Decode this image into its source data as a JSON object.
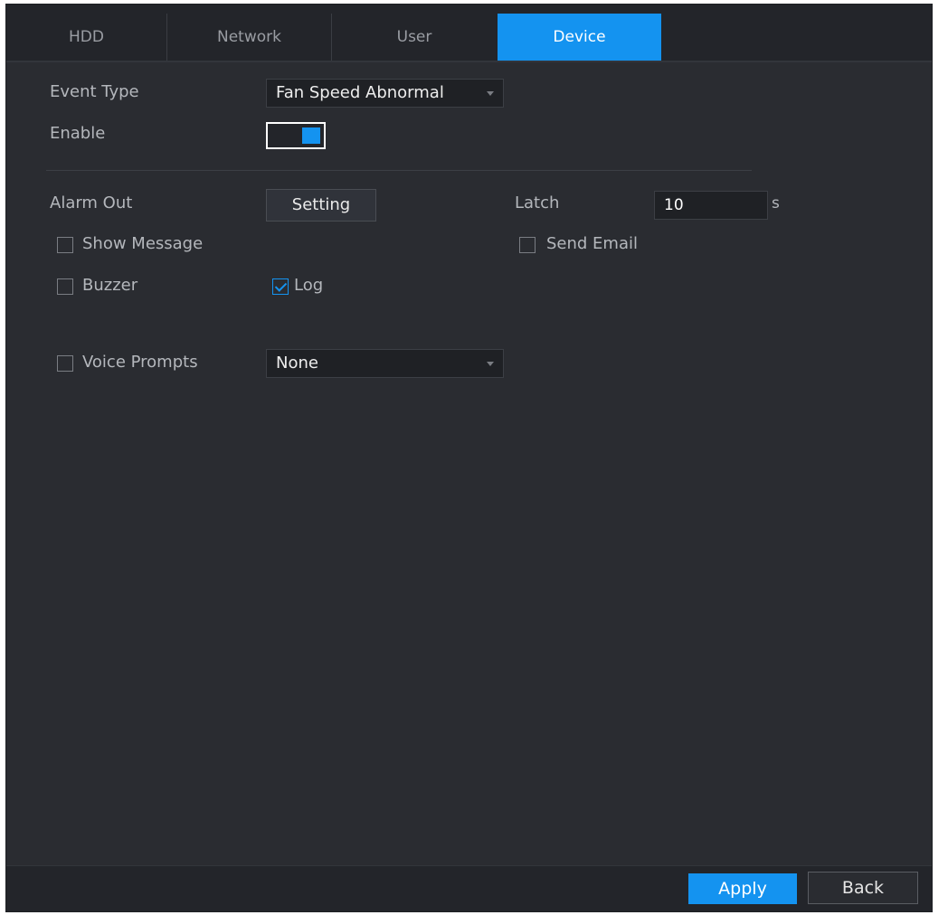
{
  "tabs": [
    {
      "label": "HDD",
      "active": false
    },
    {
      "label": "Network",
      "active": false
    },
    {
      "label": "User",
      "active": false
    },
    {
      "label": "Device",
      "active": true
    }
  ],
  "form": {
    "event_type_label": "Event Type",
    "event_type_value": "Fan Speed Abnormal",
    "enable_label": "Enable",
    "enable_on": true,
    "alarm_out_label": "Alarm Out",
    "setting_button": "Setting",
    "latch_label": "Latch",
    "latch_value": "10",
    "latch_unit": "s",
    "show_message_label": "Show Message",
    "show_message_checked": false,
    "send_email_label": "Send Email",
    "send_email_checked": false,
    "buzzer_label": "Buzzer",
    "buzzer_checked": false,
    "log_label": "Log",
    "log_checked": true,
    "voice_prompts_label": "Voice Prompts",
    "voice_prompts_checked": false,
    "voice_prompts_value": "None"
  },
  "footer": {
    "apply_label": "Apply",
    "back_label": "Back"
  },
  "colors": {
    "accent": "#1493f0",
    "panel": "#2a2c31"
  }
}
